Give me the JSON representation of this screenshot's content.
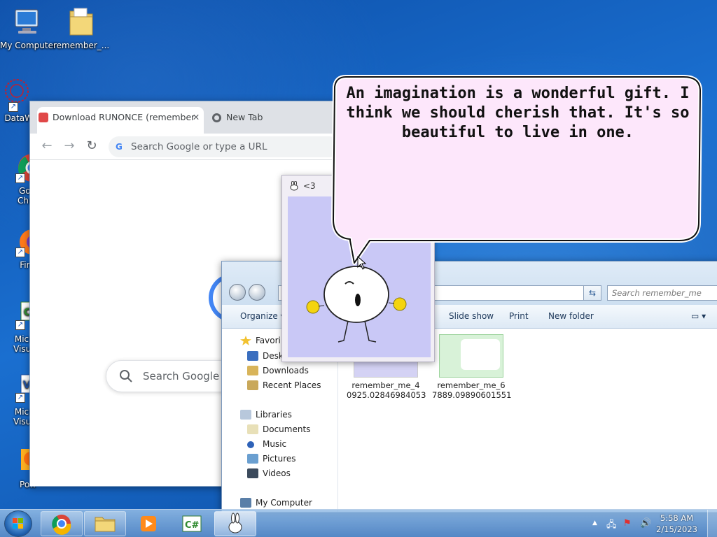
{
  "desktop": {
    "icons": [
      {
        "label": "My Computer"
      },
      {
        "label": "remember_..."
      },
      {
        "label": "DataWa"
      },
      {
        "label": "Goo\nChro"
      },
      {
        "label": "Fire"
      },
      {
        "label": "Micro\nVisual"
      },
      {
        "label": "Micro\nVisual"
      },
      {
        "label": "Pow"
      }
    ]
  },
  "chrome": {
    "tabs": [
      {
        "label": "Download RUNONCE (remember"
      },
      {
        "label": "New Tab"
      }
    ],
    "omnibox_placeholder": "Search Google or type a URL",
    "search_placeholder": "Search Google o"
  },
  "explorer": {
    "search_placeholder": "Search remember_me",
    "commands": {
      "organize": "Organize",
      "slideshow": "Slide show",
      "print": "Print",
      "new_folder": "New folder"
    },
    "nav": {
      "favorites": "Favori",
      "desktop": "Deskt",
      "downloads": "Downloads",
      "recent": "Recent Places",
      "libraries": "Libraries",
      "documents": "Documents",
      "music": "Music",
      "pictures": "Pictures",
      "videos": "Videos",
      "computer": "My Computer"
    },
    "files": [
      {
        "name": "remember_me_4\n0925.02846984053"
      },
      {
        "name": "remember_me_6\n7889.09890601551"
      }
    ]
  },
  "pet_window": {
    "title": "<3"
  },
  "bubble": {
    "text": "An imagination is a wonderful gift. I think we should cherish that. It's so beautiful to live in one."
  },
  "taskbar": {
    "time": "5:58 AM",
    "date": "2/15/2023"
  },
  "colors": {
    "bubble_fill": "#fde7fb",
    "pet_canvas": "#c9c8f6",
    "desktop": "#1560b8"
  }
}
